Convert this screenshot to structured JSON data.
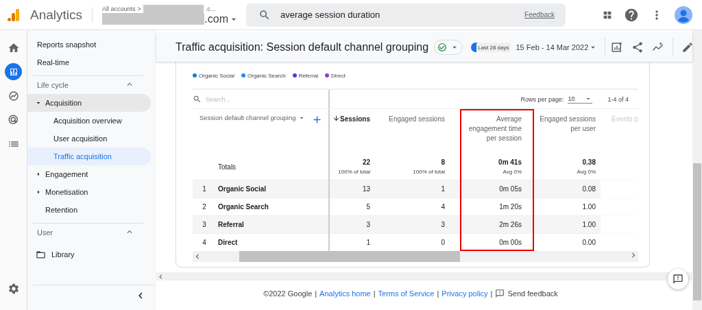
{
  "topbar": {
    "product": "Analytics",
    "breadcrumb_root": "All accounts",
    "breadcrumb_sep": ">",
    "breadcrumb_tail": ".c...",
    "property_suffix": ".com",
    "search": {
      "value": "average session duration",
      "feedback": "Feedback"
    }
  },
  "rail": [
    {
      "kind": "home",
      "selected": false
    },
    {
      "kind": "reports",
      "selected": true
    },
    {
      "kind": "explore",
      "selected": false
    },
    {
      "kind": "advertising",
      "selected": false
    },
    {
      "kind": "configure",
      "selected": false
    }
  ],
  "sidebar": {
    "items": [
      {
        "label": "Reports snapshot"
      },
      {
        "label": "Real-time"
      }
    ],
    "sections": [
      {
        "label": "Life cycle",
        "expanded": true,
        "children": [
          {
            "label": "Acquisition",
            "kind": "group",
            "expanded": true,
            "children": [
              {
                "label": "Acquisition overview",
                "selected": false
              },
              {
                "label": "User acquisition",
                "selected": false
              },
              {
                "label": "Traffic acquisition",
                "selected": true
              }
            ]
          },
          {
            "label": "Engagement",
            "kind": "group",
            "expanded": false
          },
          {
            "label": "Monetisation",
            "kind": "group",
            "expanded": false
          },
          {
            "label": "Retention",
            "kind": "link"
          }
        ]
      },
      {
        "label": "User",
        "expanded": true
      }
    ],
    "library": "Library"
  },
  "header": {
    "title": "Traffic acquisition: Session default channel grouping",
    "compare_label": "Last 28 days",
    "date_range": "15 Feb - 14 Mar 2022"
  },
  "legend": [
    {
      "label": "Organic Social",
      "color": "#1a7ec4"
    },
    {
      "label": "Organic Search",
      "color": "#2b86f0"
    },
    {
      "label": "Referral",
      "color": "#4b3fe0"
    },
    {
      "label": "Direct",
      "color": "#8e3fd6"
    }
  ],
  "table": {
    "search_placeholder": "Search...",
    "rows_per_page_label": "Rows per page:",
    "rows_per_page": "10",
    "range": "1-4 of 4",
    "dimension_header": "Session default channel grouping",
    "totals_label": "Totals",
    "rows": [
      {
        "index": "1",
        "name": "Organic Social"
      },
      {
        "index": "2",
        "name": "Organic Search"
      },
      {
        "index": "3",
        "name": "Referral"
      },
      {
        "index": "4",
        "name": "Direct"
      }
    ],
    "columns": [
      {
        "label": "Sessions",
        "sorted": true,
        "highlighted": false,
        "total": "22",
        "total_note": "100% of total",
        "values": [
          "13",
          "5",
          "3",
          "1"
        ]
      },
      {
        "label": "Engaged sessions",
        "sorted": false,
        "highlighted": false,
        "total": "8",
        "total_note": "100% of total",
        "values": [
          "1",
          "4",
          "3",
          "0"
        ]
      },
      {
        "label": "Average engagement time per session",
        "sorted": false,
        "highlighted": true,
        "total": "0m 41s",
        "total_note": "Avg 0%",
        "values": [
          "0m 05s",
          "1m 20s",
          "2m 26s",
          "0m 00s"
        ]
      },
      {
        "label": "Engaged sessions per user",
        "sorted": false,
        "highlighted": false,
        "total": "0.38",
        "total_note": "Avg 0%",
        "values": [
          "0.08",
          "1.00",
          "1.00",
          "0.00"
        ]
      },
      {
        "label": "Events p",
        "sorted": false,
        "highlighted": false
      }
    ]
  },
  "footer": {
    "separator": "|",
    "copyright": "©2022 Google",
    "links": [
      "Analytics home",
      "Terms of Service",
      "Privacy policy"
    ],
    "send_feedback": "Send feedback"
  }
}
